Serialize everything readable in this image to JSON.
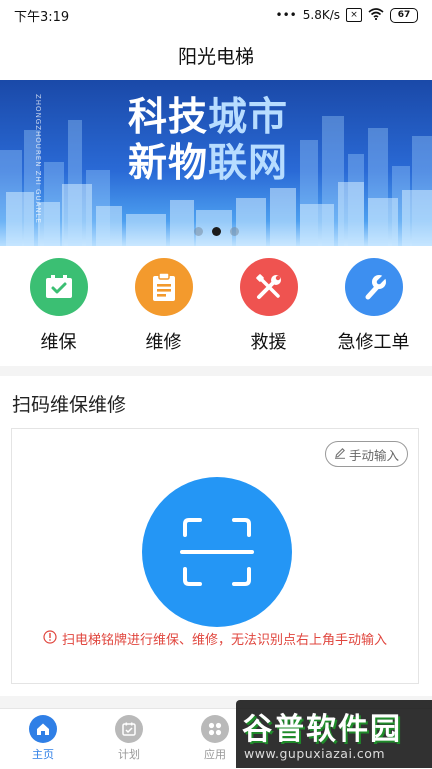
{
  "status_bar": {
    "time": "下午3:19",
    "signal_dots": "•••",
    "speed": "5.8K/s",
    "sim_icon": "sim-x-icon",
    "sim_glyph": "×",
    "wifi_icon": "wifi-icon",
    "battery": "67"
  },
  "header": {
    "title": "阳光电梯"
  },
  "banner": {
    "vertical_text": "ZHONGZHOUREN ZHI GUANLE",
    "line1": {
      "part_white": "科技",
      "part_blue": "城市"
    },
    "line2": {
      "part_white": "新物",
      "part_blue": "联网"
    },
    "page_count": 3,
    "active_page": 2
  },
  "quick_actions": [
    {
      "label": "维保",
      "icon": "battery-check-icon",
      "color": "#3bbf73"
    },
    {
      "label": "维修",
      "icon": "clipboard-icon",
      "color": "#f39a2d"
    },
    {
      "label": "救援",
      "icon": "tools-icon",
      "color": "#ef5350"
    },
    {
      "label": "急修工单",
      "icon": "wrench-icon",
      "color": "#3d8ff0"
    }
  ],
  "scan_section": {
    "title": "扫码维保维修",
    "manual_button": "手动输入",
    "scan_icon": "qr-scan-icon",
    "hint": "扫电梯铭牌进行维保、维修，无法识别点右上角手动输入"
  },
  "tabs": [
    {
      "label": "主页",
      "icon": "home-icon",
      "active": true
    },
    {
      "label": "计划",
      "icon": "calendar-icon",
      "active": false
    },
    {
      "label": "应用",
      "icon": "apps-icon",
      "active": false
    }
  ],
  "watermark": {
    "title": "谷普软件园",
    "url": "www.gupuxiazai.com"
  },
  "colors": {
    "primary": "#2496f5",
    "hint_red": "#e0463e",
    "active_tab": "#2f7fe6"
  }
}
